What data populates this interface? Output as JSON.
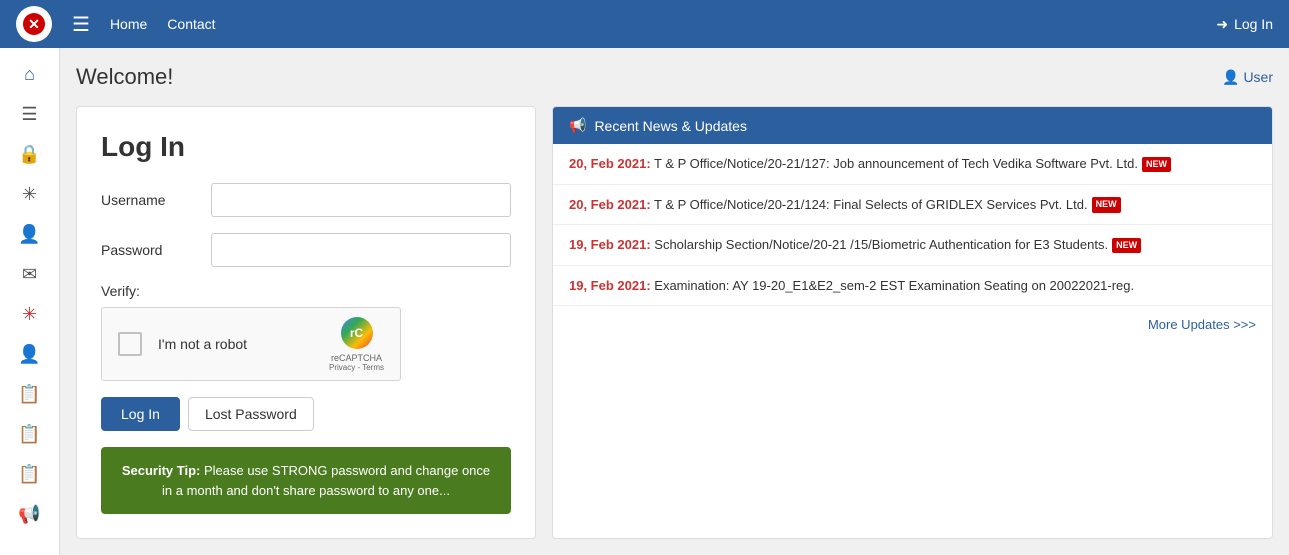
{
  "navbar": {
    "home_label": "Home",
    "contact_label": "Contact",
    "login_label": "Log In",
    "hamburger_icon": "☰"
  },
  "welcome": {
    "title": "Welcome!",
    "user_label": "User"
  },
  "login_card": {
    "title": "Log In",
    "username_label": "Username",
    "password_label": "Password",
    "verify_label": "Verify:",
    "recaptcha_text": "I'm not a robot",
    "recaptcha_brand": "reCAPTCHA",
    "recaptcha_links": "Privacy  -  Terms",
    "login_button": "Log In",
    "lost_password_button": "Lost Password",
    "security_tip_bold": "Security Tip:",
    "security_tip_text": " Please use STRONG password and change once in a month and don't share password to any one..."
  },
  "news": {
    "header": "Recent News & Updates",
    "items": [
      {
        "date": "20, Feb 2021:",
        "text": " T & P Office/Notice/20-21/127: Job announcement of Tech Vedika Software Pvt. Ltd.",
        "new": true
      },
      {
        "date": "20, Feb 2021:",
        "text": " T & P Office/Notice/20-21/124: Final Selects of GRIDLEX Services Pvt. Ltd.",
        "new": true
      },
      {
        "date": "19, Feb 2021:",
        "text": " Scholarship Section/Notice/20-21 /15/Biometric Authentication for E3 Students.",
        "new": true
      },
      {
        "date": "19, Feb 2021:",
        "text": " Examination: AY 19-20_E1&E2_sem-2 EST Examination Seating on 20022021-reg.",
        "new": false
      }
    ],
    "more_updates": "More Updates >>>"
  },
  "sidebar": {
    "items": [
      {
        "icon": "⌂",
        "name": "home"
      },
      {
        "icon": "☰",
        "name": "list"
      },
      {
        "icon": "🔒",
        "name": "lock"
      },
      {
        "icon": "✳",
        "name": "asterisk"
      },
      {
        "icon": "👤",
        "name": "user"
      },
      {
        "icon": "✉",
        "name": "mail"
      },
      {
        "icon": "✳",
        "name": "asterisk2"
      },
      {
        "icon": "👤",
        "name": "user2"
      },
      {
        "icon": "📋",
        "name": "clipboard"
      },
      {
        "icon": "📋",
        "name": "clipboard2"
      },
      {
        "icon": "📋",
        "name": "clipboard3"
      },
      {
        "icon": "📢",
        "name": "megaphone"
      }
    ]
  },
  "colors": {
    "navbar_bg": "#2c5f9e",
    "login_btn": "#2c5f9e",
    "security_tip_bg": "#4a7c1f",
    "news_date": "#cc3333"
  }
}
